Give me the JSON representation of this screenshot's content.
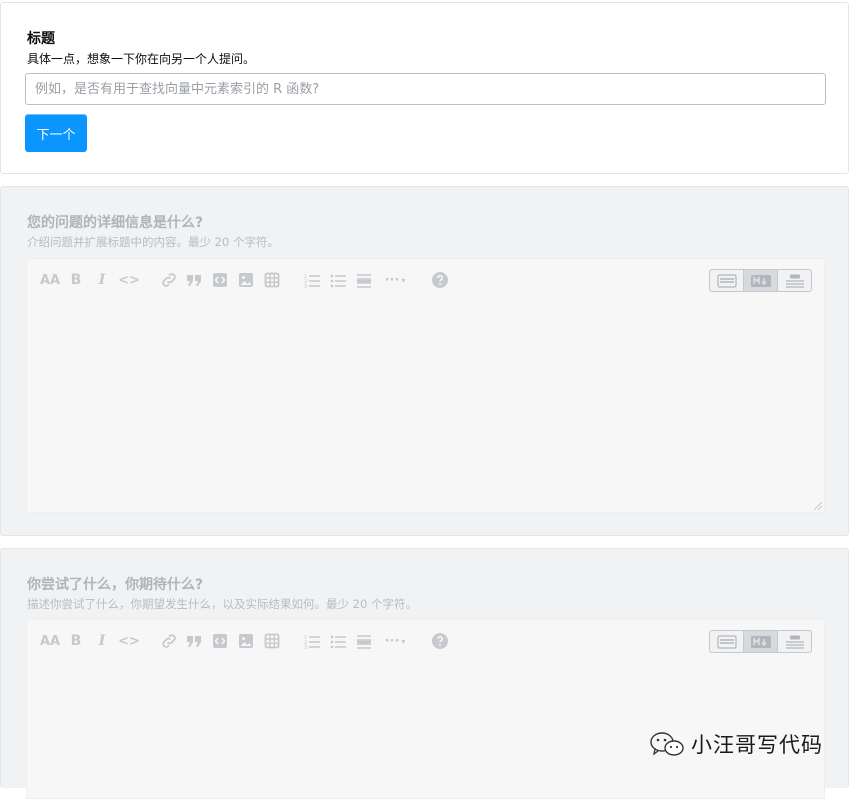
{
  "title_card": {
    "label": "标题",
    "description": "具体一点，想象一下你在向另一个人提问。",
    "input_value": "",
    "input_placeholder": "例如，是否有用于查找向量中元素索引的 R 函数?",
    "next_button": "下一个"
  },
  "details_card": {
    "title": "您的问题的详细信息是什么?",
    "description": "介绍问题并扩展标题中的内容。最少 20 个字符。"
  },
  "tried_card": {
    "title": "你尝试了什么，你期待什么?",
    "description": "描述你尝试了什么，你期望发生什么，以及实际结果如何。最少 20 个字符。"
  },
  "toolbar": {
    "heading_glyph": "AA",
    "bold_glyph": "B",
    "italic_glyph": "I",
    "code_glyph": "<>",
    "more_glyph": "···",
    "icons": [
      "heading-icon",
      "bold-icon",
      "italic-icon",
      "code-icon",
      "link-icon",
      "blockquote-icon",
      "code-snippet-icon",
      "image-icon",
      "table-icon",
      "ordered-list-icon",
      "unordered-list-icon",
      "horizontal-rule-icon",
      "more-icon",
      "help-icon"
    ],
    "modes": [
      "rich-text-mode-icon",
      "markdown-mode-icon",
      "preview-mode-icon"
    ],
    "active_mode": "markdown"
  },
  "watermark": {
    "text": "小汪哥写代码"
  },
  "colors": {
    "primary": "#0a95ff",
    "dim_bg": "#f1f2f3",
    "dim_text": "#b0b4b8"
  }
}
